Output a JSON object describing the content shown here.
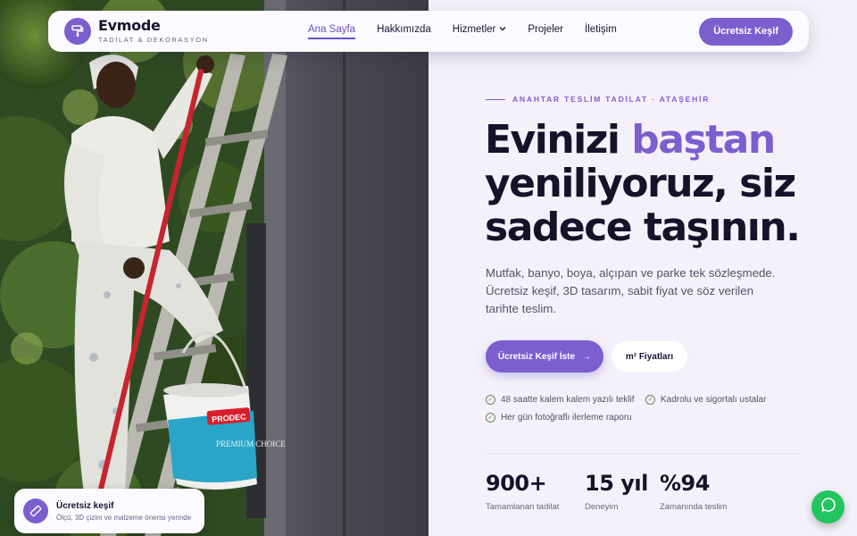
{
  "brand": {
    "name": "Evmode",
    "tagline": "TADİLAT & DEKORASYON",
    "accent_color": "#7b5fcf"
  },
  "nav": {
    "links": [
      {
        "label": "Ana Sayfa",
        "active": true
      },
      {
        "label": "Hakkımızda"
      },
      {
        "label": "Hizmetler",
        "has_dropdown": true
      },
      {
        "label": "Projeler"
      },
      {
        "label": "İletişim"
      }
    ],
    "cta": "Ücretsiz Keşif"
  },
  "hero": {
    "eyebrow": "ANAHTAR TESLİM TADİLAT · ATAŞEHİR",
    "headline_line1_a": "Evinizi ",
    "headline_line1_accent": "baştan",
    "headline_line2": "yeniliyoruz, siz",
    "headline_line3": "sadece taşının.",
    "lead": "Mutfak, banyo, boya, alçıpan ve parke tek sözleşmede. Ücretsiz keşif, 3D tasarım, sabit fiyat ve söz verilen tarihte teslim.",
    "primary_button": "Ücretsiz Keşif İste",
    "primary_button_arrow": "→",
    "secondary_button": "m² Fiyatları",
    "features": [
      "48 saatte kalem kalem yazılı teklif",
      "Kadrolu ve sigortalı ustalar",
      "Her gün fotoğraflı ilerleme raporu"
    ],
    "stats": [
      {
        "value": "900+",
        "label": "Tamamlanan tadilat"
      },
      {
        "value": "15 yıl",
        "label": "Deneyim"
      },
      {
        "value": "%94",
        "label": "Zamanında teslim"
      }
    ]
  },
  "photo": {
    "bucket_brand": "PRODEC",
    "bucket_text": "PREMIUM CHOICE"
  },
  "float_card": {
    "title": "Ücretsiz keşif",
    "subtitle": "Ölçü, 3D çizim ve malzeme önerisi yerinde"
  },
  "icons": {
    "logo": "paint-roller-icon",
    "check": "check-circle-icon",
    "float": "ruler-icon",
    "chat": "whatsapp-icon"
  }
}
